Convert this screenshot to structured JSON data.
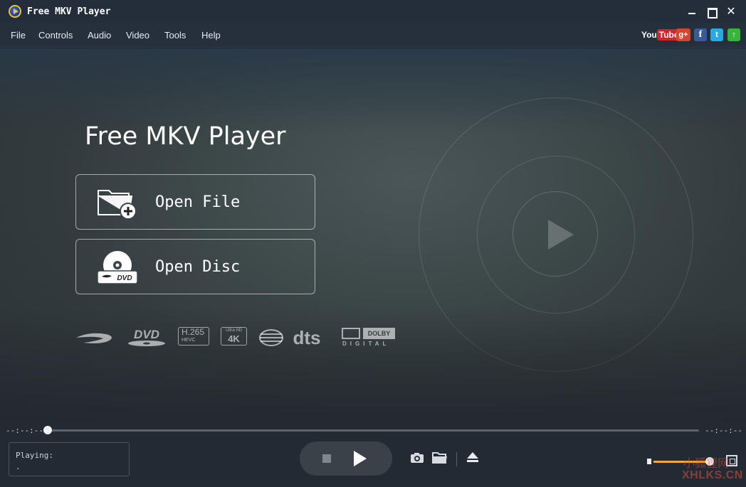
{
  "window": {
    "title": "Free MKV Player",
    "close_glyph": "✕"
  },
  "menu": {
    "items": [
      "File",
      "Controls",
      "Audio",
      "Video",
      "Tools",
      "Help"
    ]
  },
  "social": {
    "youtube_you": "You",
    "youtube_tube": "Tube",
    "google_plus": "g+",
    "facebook": "f",
    "twitter": "t",
    "upgrade": "↑"
  },
  "hero": {
    "title": "Free MKV Player",
    "open_file_label": "Open File",
    "open_disc_label": "Open Disc",
    "disc_badge": "DVD"
  },
  "formats": {
    "dvd": "DVD",
    "h265": "H.265",
    "hevc": "HEVC",
    "ultra_hd": "Ultra HD",
    "k4": "4K",
    "dts": "dts",
    "dolby": "DOLBY",
    "digital": "DIGITAL"
  },
  "playback": {
    "time_elapsed": "--:--:--",
    "time_total": "--:--:--",
    "progress": 0,
    "playing_label": "Playing:",
    "playing_value": "-",
    "volume": 1.0
  },
  "watermark": {
    "line1": "小狐狸网",
    "line2": "XHLKS.CN"
  }
}
